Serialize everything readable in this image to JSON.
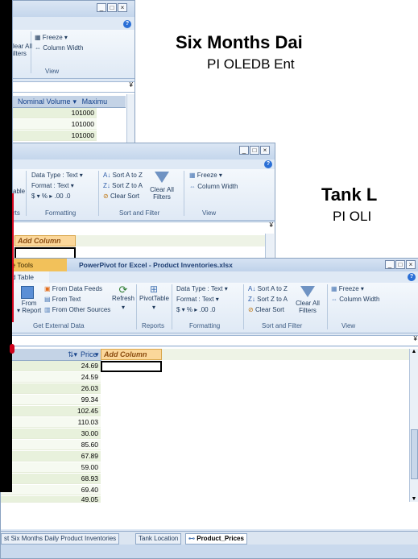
{
  "headings": {
    "six_months_title": "Six Months Dai",
    "six_months_subtitle": "PI OLEDB Ent",
    "tank_title": "Tank L",
    "tank_subtitle": "PI OLI"
  },
  "win_back": {
    "freeze_label": "Freeze",
    "column_width_label": "Column Width",
    "clear_all_label": "lear All",
    "filters_label": "ilters",
    "view_label": "View",
    "header": {
      "nominal_volume": "Nominal Volume",
      "maximum": "Maximu"
    },
    "values": [
      "101000",
      "101000",
      "101000"
    ]
  },
  "win_mid": {
    "data_type_label": "Data Type : Text",
    "format_label": "Format : Text",
    "sort_az_label": "Sort A to Z",
    "sort_za_label": "Sort Z to A",
    "clear_sort_label": "Clear Sort",
    "clear_all_filters_label": "Clear All Filters",
    "freeze_label": "Freeze",
    "column_width_label": "Column Width",
    "groups": {
      "rts": "rts",
      "formatting": "Formatting",
      "sort_filter": "Sort and Filter",
      "view": "View"
    },
    "table_label": "able",
    "add_column": "Add Column"
  },
  "win_front": {
    "title_tab": "able Tools",
    "title": "PowerPivot for Excel - Product Inventories.xlsx",
    "subtab": "nked Table",
    "from_data_feeds": "From Data Feeds",
    "from_text": "From Text",
    "from_report": "From Report",
    "from_other_sources": "From Other Sources",
    "refresh": "Refresh",
    "pivot_table": "PivotTable",
    "data_type_label": "Data Type : Text",
    "format_label": "Format : Text",
    "sort_az_label": "Sort A to Z",
    "sort_za_label": "Sort Z to A",
    "clear_sort_label": "Clear Sort",
    "clear_all_filters_label": "Clear All Filters",
    "freeze_label": "Freeze",
    "column_width_label": "Column Width",
    "groups": {
      "external": "Get External Data",
      "reports": "Reports",
      "formatting": "Formatting",
      "sort_filter": "Sort and Filter",
      "view": "View"
    },
    "price_header": "Price",
    "add_column": "Add Column",
    "prices": [
      "24.69",
      "24.59",
      "26.03",
      "99.34",
      "102.45",
      "110.03",
      "30.00",
      "85.60",
      "67.89",
      "59.00",
      "68.93",
      "69.40",
      "49.05"
    ],
    "sheet_tabs": [
      "st Six Months Daily Product Inventories",
      "Tank Location",
      "Product_Prices"
    ]
  },
  "colors": {
    "accent_title": "#1f3f73",
    "row_green": "#e8f1dc",
    "add_column_bg": "#fbd79a"
  }
}
